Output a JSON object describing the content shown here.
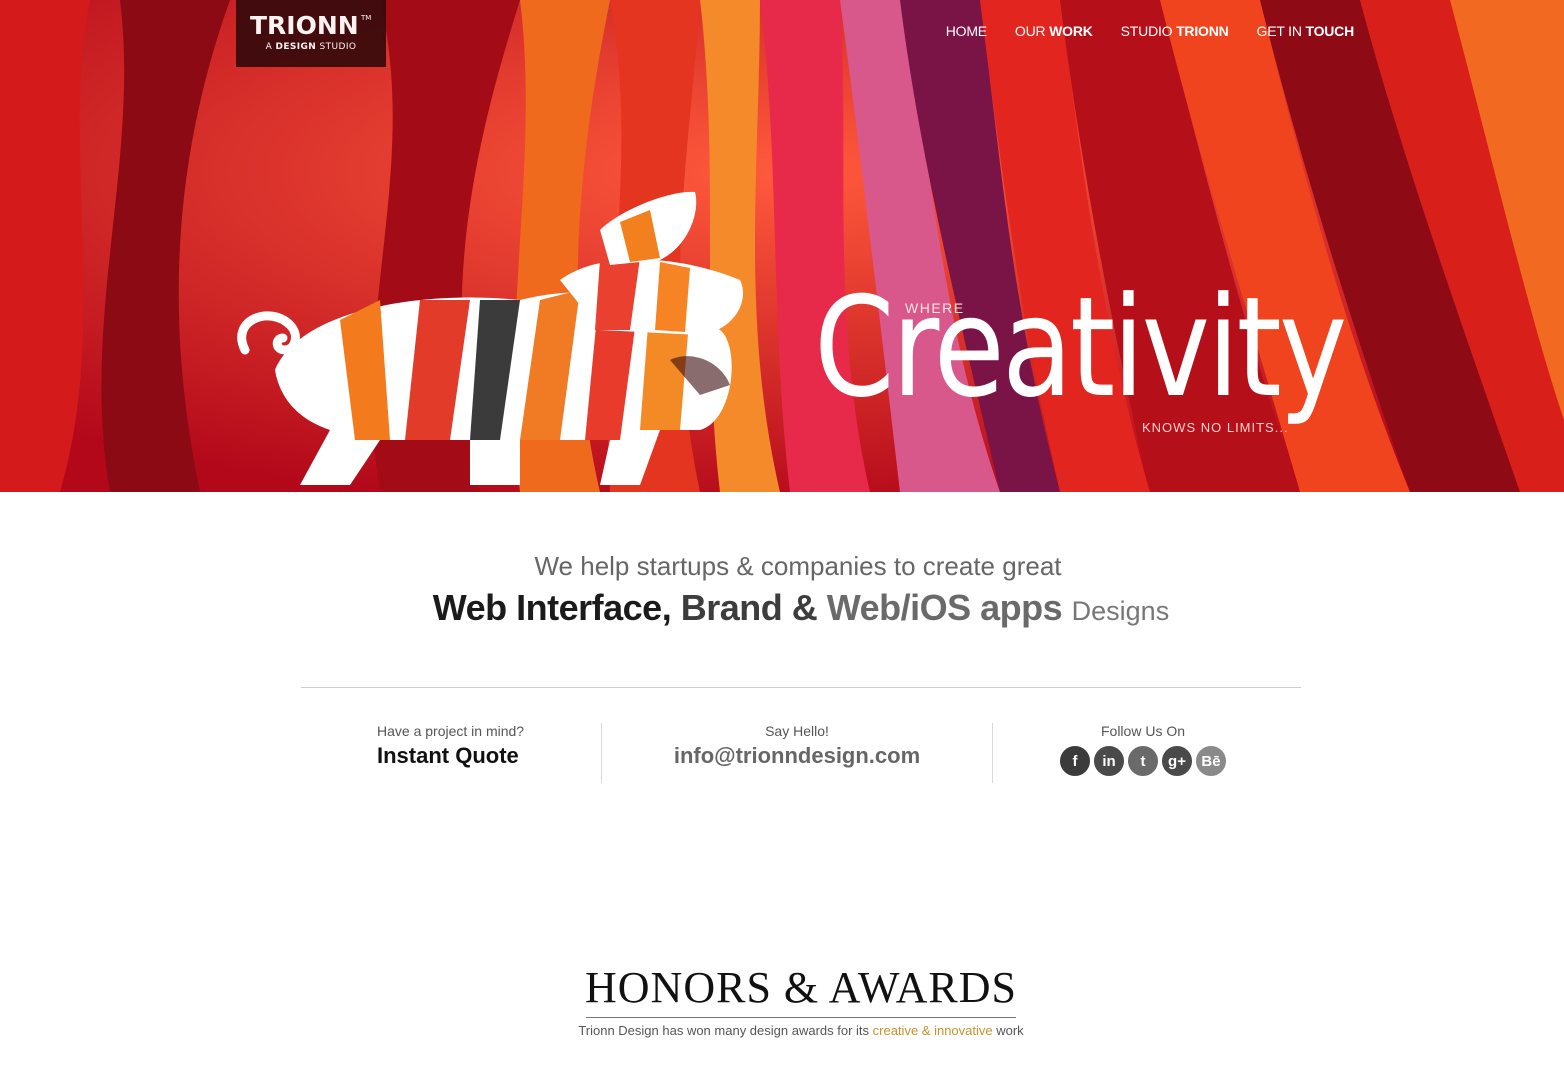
{
  "brand": {
    "logo_word": "TRIONN",
    "logo_tm": "TM",
    "logo_sub_prefix": "A",
    "logo_sub_bold": "DESIGN",
    "logo_sub_suffix": "STUDIO"
  },
  "nav": {
    "home": {
      "a": "HOME",
      "b": ""
    },
    "work": {
      "a": "OUR",
      "b": "WORK"
    },
    "studio": {
      "a": "STUDIO",
      "b": "TRIONN"
    },
    "touch": {
      "a": "GET IN",
      "b": "TOUCH"
    }
  },
  "hero": {
    "where": "WHERE",
    "headline": "Creativity",
    "tagline": "KNOWS NO LIMITS..."
  },
  "intro": {
    "line1": "We help startups & companies to create great",
    "part1": "Web Interface,",
    "part2": "Brand &",
    "part3": "Web/iOS apps",
    "part4": "Designs"
  },
  "contact": {
    "quote_label": "Have a project in mind?",
    "quote_link": "Instant Quote",
    "hello_label": "Say Hello!",
    "hello_email": "info@trionndesign.com",
    "follow_label": "Follow Us On",
    "socials": [
      {
        "glyph": "f",
        "icon": "facebook-icon",
        "color": "#3b3b3b"
      },
      {
        "glyph": "in",
        "icon": "linkedin-icon",
        "color": "#4a4a4a"
      },
      {
        "glyph": "t",
        "icon": "twitter-icon",
        "color": "#6a6a6a"
      },
      {
        "glyph": "g+",
        "icon": "google-plus-icon",
        "color": "#4a4a4a"
      },
      {
        "glyph": "Bē",
        "icon": "behance-icon",
        "color": "#8a8a8a"
      }
    ]
  },
  "honors": {
    "title": "HONORS & AWARDS",
    "sub_before": "Trionn Design has won many design awards for its",
    "sub_accent": "creative & innovative",
    "sub_after": "work"
  },
  "colors": {
    "hero_red": "#c4101c",
    "accent_orange": "#f2801f",
    "accent_gold": "#c8922e",
    "logo_bg": "#3a0a0c"
  }
}
